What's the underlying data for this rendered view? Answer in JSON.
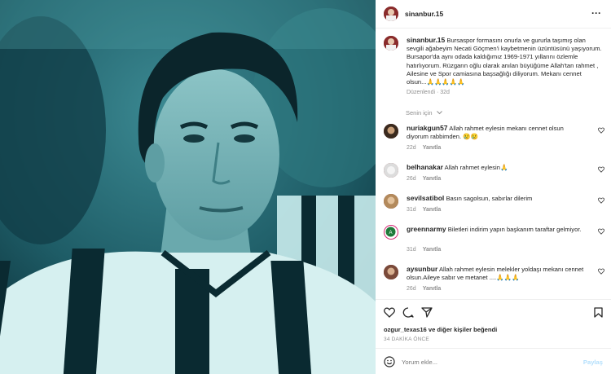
{
  "post": {
    "username": "sinanbur.15",
    "more_icon": "more-horizontal-icon",
    "caption_username": "sinanbur.15",
    "caption_text": "Bursaspor formasını onurla ve gururla taşımış olan sevgili ağabeyim Necati Göçmen'i kaybetmenin üzüntüsünü yaşıyorum. Bursapor'da aynı odada kaldığımız 1969-1971 yıllarını özlemle hatırlıyorum. Rüzgarın oğlu olarak anılan büyüğüme Allah'tan rahmet , Ailesine ve Spor camiasına başsağlığı diliyorum. Mekanı cennet olsun...🙏🙏🙏🙏🙏",
    "caption_meta": "Düzenlendi · 32d",
    "for_you": "Senin için"
  },
  "comments": [
    {
      "username": "nuriakgun57",
      "text": "Allah rahmet eylesin mekanı cennet olsun diyorum rabbimden. 😢😢",
      "age": "22d",
      "reply": "Yanıtla"
    },
    {
      "username": "belhanakar",
      "text": "Allah rahmet eylesin🙏",
      "age": "26d",
      "reply": "Yanıtla"
    },
    {
      "username": "sevilsatibol",
      "text": "Basın sagolsun, sabırlar dilerim",
      "age": "31d",
      "reply": "Yanıtla"
    },
    {
      "username": "greennarmy",
      "text": "Biletleri indirim yapın başkanım taraftar gelmiyor.",
      "age": "31d",
      "reply": "Yanıtla"
    },
    {
      "username": "aysunbur",
      "text": "Allah rahmet eylesin melekler yoldaşı mekanı cennet olsun.Aileye sabır ve metanet ....🙏🙏🙏",
      "age": "26d",
      "reply": "Yanıtla"
    }
  ],
  "actions": {
    "like_icon": "heart-icon",
    "comment_icon": "comment-icon",
    "share_icon": "send-icon",
    "save_icon": "bookmark-icon"
  },
  "likes_text": "ozgur_texas16 ve diğer kişiler beğendi",
  "time_ago": "34 DAKİKA ÖNCE",
  "add_comment": {
    "placeholder": "Yorum ekle...",
    "post_label": "Paylaş",
    "emoji_icon": "emoji-icon"
  }
}
